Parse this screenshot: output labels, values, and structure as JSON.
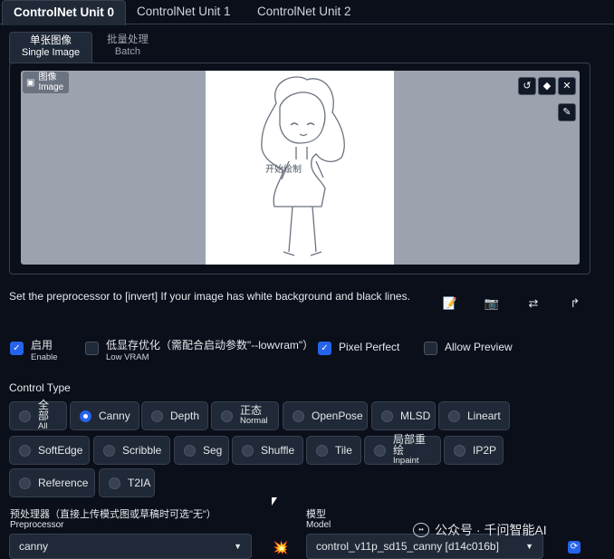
{
  "unit_tabs": [
    "ControlNet Unit 0",
    "ControlNet Unit 1",
    "ControlNet Unit 2"
  ],
  "mode_tabs": [
    {
      "cn": "单张图像",
      "en": "Single Image"
    },
    {
      "cn": "批量处理",
      "en": "Batch"
    }
  ],
  "image_box": {
    "label_cn": "图像",
    "label_en": "Image",
    "canvas_text": "开始绘制",
    "tools": [
      "undo-icon",
      "eraser-icon",
      "close-icon",
      "brush-icon"
    ]
  },
  "hint_text": "Set the preprocessor to [invert] If your image has white background and black lines.",
  "action_icons": [
    "edit-icon",
    "camera-icon",
    "swap-icon",
    "send-icon"
  ],
  "checkboxes": {
    "enable": {
      "cn": "启用",
      "en": "Enable",
      "checked": true
    },
    "low_vram": {
      "cn": "低显存优化（需配合启动参数\"--lowvram\"）",
      "en": "Low VRAM",
      "checked": false
    },
    "pixel_perfect": {
      "label": "Pixel Perfect",
      "checked": true
    },
    "allow_preview": {
      "label": "Allow Preview",
      "checked": false
    }
  },
  "control_type": {
    "label": "Control Type",
    "selected": "Canny",
    "row1": [
      {
        "cn": "全部",
        "en": "All"
      },
      {
        "label": "Canny"
      },
      {
        "label": "Depth"
      },
      {
        "cn": "正态",
        "en": "Normal"
      },
      {
        "label": "OpenPose"
      },
      {
        "label": "MLSD"
      },
      {
        "label": "Lineart"
      }
    ],
    "row2": [
      {
        "label": "SoftEdge"
      },
      {
        "label": "Scribble"
      },
      {
        "label": "Seg"
      },
      {
        "label": "Shuffle"
      },
      {
        "label": "Tile"
      },
      {
        "cn": "局部重绘",
        "en": "Inpaint"
      },
      {
        "label": "IP2P"
      }
    ],
    "row3": [
      {
        "label": "Reference"
      },
      {
        "label": "T2IA"
      }
    ]
  },
  "preprocessor": {
    "label_cn": "预处理器（直接上传模式图或草稿时可选\"无\"）",
    "label_en": "Preprocessor",
    "value": "canny"
  },
  "model": {
    "label_cn": "模型",
    "label_en": "Model",
    "value": "control_v11p_sd15_canny [d14c016b]"
  },
  "watermark": "公众号 · 千问智能AI",
  "colors": {
    "background": "#0b0f19",
    "panel": "#1f2937",
    "accent": "#2563eb",
    "border": "#374151"
  }
}
